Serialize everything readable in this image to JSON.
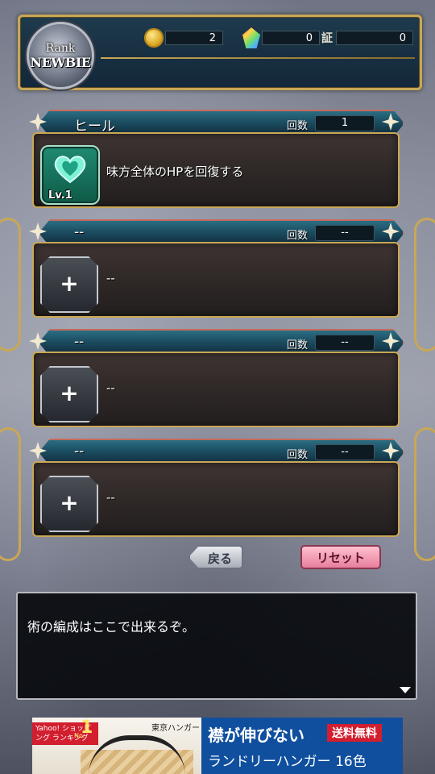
{
  "header": {
    "rank_label": "Rank",
    "rank_value": "NEWBIE",
    "coins": "2",
    "gems": "0",
    "cert_label": "証",
    "certs": "0"
  },
  "slots": [
    {
      "title": "ヒール",
      "count_label": "回数",
      "count": "1",
      "desc": "味方全体のHPを回復する",
      "level": "Lv.1",
      "has_skill": true,
      "icon": "heal-heart-icon"
    },
    {
      "title": "--",
      "count_label": "回数",
      "count": "--",
      "desc": "--",
      "has_skill": false,
      "plus": "+"
    },
    {
      "title": "--",
      "count_label": "回数",
      "count": "--",
      "desc": "--",
      "has_skill": false,
      "plus": "+"
    },
    {
      "title": "--",
      "count_label": "回数",
      "count": "--",
      "desc": "--",
      "has_skill": false,
      "plus": "+"
    }
  ],
  "buttons": {
    "back": "戻る",
    "reset": "リセット"
  },
  "dialog": {
    "text": "術の編成はここで出来るぞ。"
  },
  "ad": {
    "badge": "Yahoo! ショッピング ランキング",
    "badge_no": "No.",
    "rank_num": "1",
    "store": "東京ハンガー",
    "headline": "襟が伸びない",
    "free_shipping": "送料無料",
    "sub": "ランドリーハンガー 16色"
  }
}
